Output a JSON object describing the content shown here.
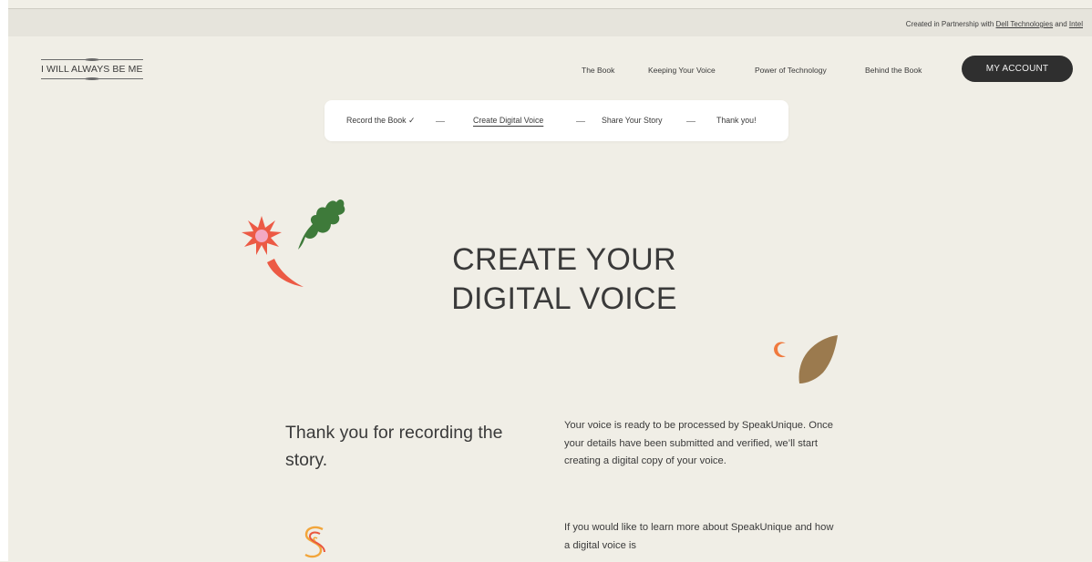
{
  "topbar": {
    "partner_prefix": "Created in Partnership with ",
    "partner_1": "Dell Technologies",
    "partner_join": " and ",
    "partner_2": "Intel"
  },
  "header": {
    "logo_text": "I WILL ALWAYS BE ME",
    "nav": [
      "The Book",
      "Keeping Your Voice",
      "Power of Technology",
      "Behind the Book"
    ],
    "account_label": "MY ACCOUNT"
  },
  "stepper": {
    "steps": [
      {
        "label": "Record the Book ✓",
        "state": "done"
      },
      {
        "label": "Create Digital Voice",
        "state": "current"
      },
      {
        "label": "Share Your Story",
        "state": "upcoming"
      },
      {
        "label": "Thank you!",
        "state": "upcoming"
      }
    ]
  },
  "main": {
    "title": "CREATE YOUR\nDIGITAL VOICE",
    "subhead": "Thank you for recording the story.",
    "paragraph_1": "Your voice is ready to be processed by SpeakUnique. Once your details have been submitted and verified, we’ll start creating a digital copy of your voice.",
    "paragraph_2": "If you would like to learn more about SpeakUnique and how a digital voice is"
  },
  "decorations": [
    "red-flower-icon",
    "green-leaf-icon",
    "orange-crescent-icon",
    "brown-leaf-icon",
    "s-logo-icon"
  ],
  "colors": {
    "background": "#f0eee6",
    "button": "#2f2f2f",
    "flower_red": "#ec5a45",
    "flower_center": "#f3a9c4",
    "leaf_green": "#3e7a3a",
    "leaf_brown": "#9b7a4e",
    "crescent_orange": "#f07a3e"
  }
}
